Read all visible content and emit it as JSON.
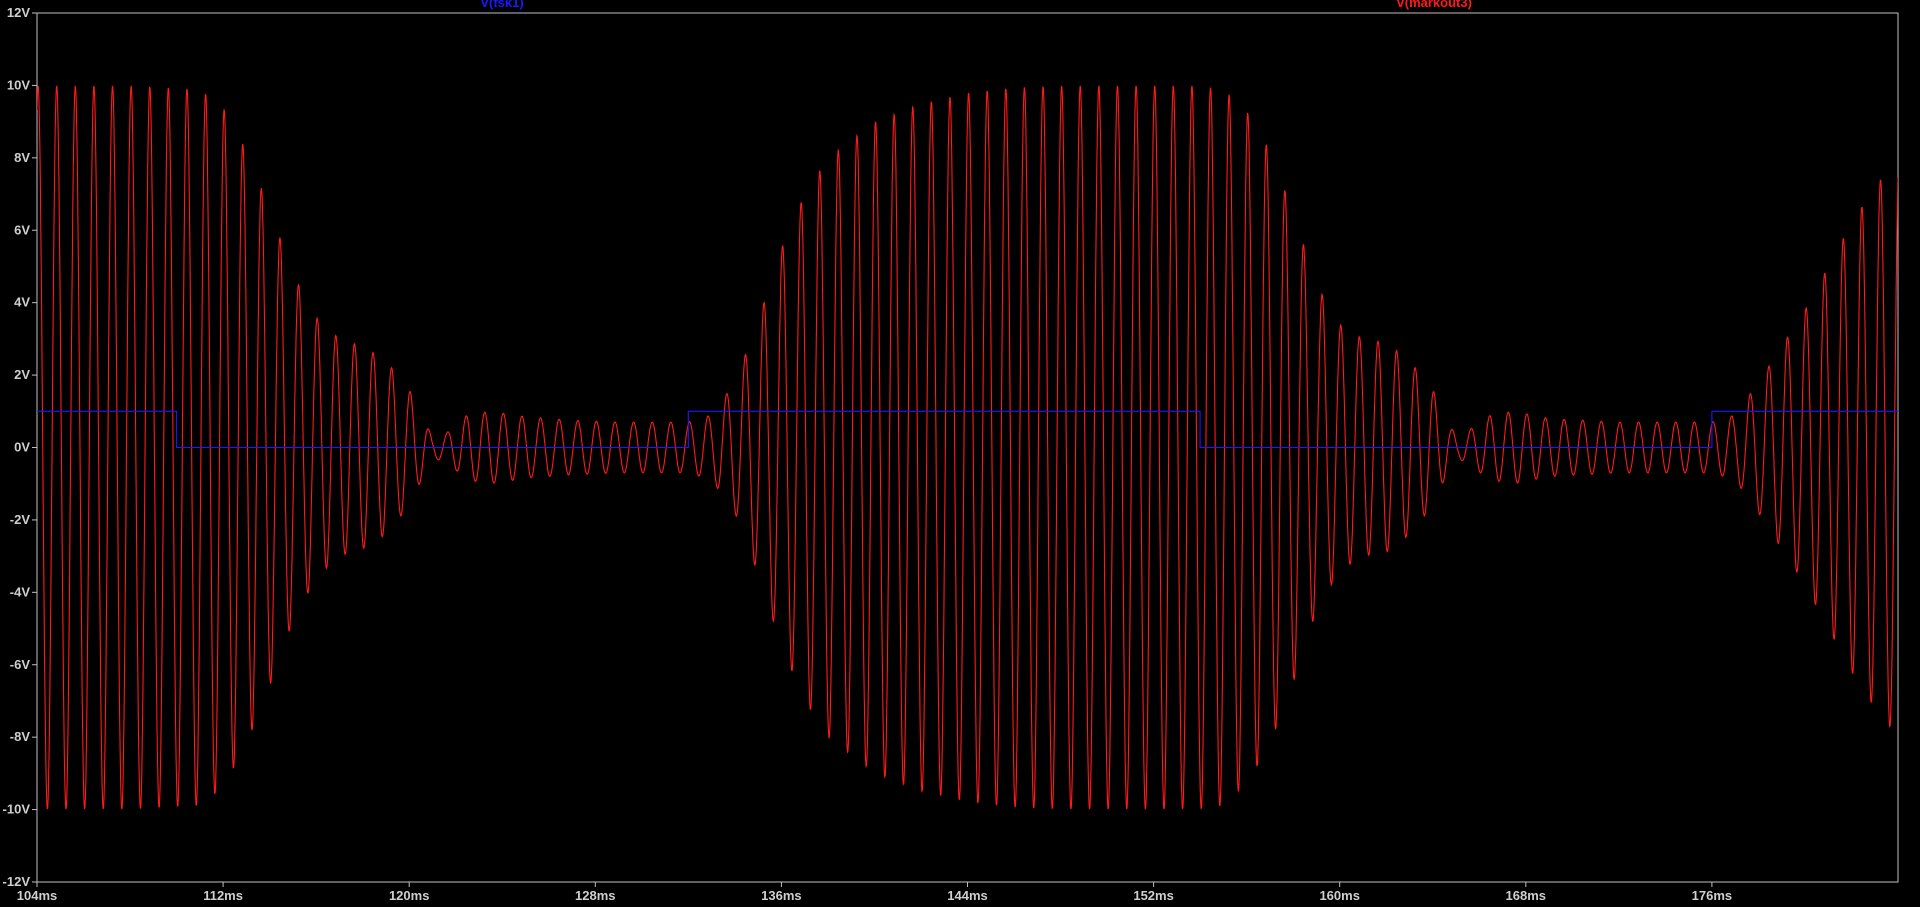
{
  "colors": {
    "background": "#000000",
    "frame": "#c0c0c0",
    "tick_text": "#cfcfcf",
    "trace_blue": "#1a1aff",
    "trace_red": "#ff1a1a"
  },
  "chart_data": {
    "type": "line",
    "title": "",
    "xlabel": "",
    "ylabel": "",
    "x_unit": "ms",
    "y_unit": "V",
    "xlim": [
      104,
      184
    ],
    "ylim": [
      -12,
      12
    ],
    "grid": false,
    "x_ticks": [
      104,
      112,
      120,
      128,
      136,
      144,
      152,
      160,
      168,
      176
    ],
    "x_tick_labels": [
      "104ms",
      "112ms",
      "120ms",
      "128ms",
      "136ms",
      "144ms",
      "152ms",
      "160ms",
      "168ms",
      "176ms"
    ],
    "y_ticks": [
      12,
      10,
      8,
      6,
      4,
      2,
      0,
      -2,
      -4,
      -6,
      -8,
      -10,
      -12
    ],
    "y_tick_labels": [
      "12V",
      "10V",
      "8V",
      "6V",
      "4V",
      "2V",
      "0V",
      "-2V",
      "-4V",
      "-6V",
      "-8V",
      "-10V",
      "-12V"
    ],
    "series": [
      {
        "name": "V(fsk1)",
        "color": "#1a1aff",
        "kind": "digital",
        "x": [
          104,
          110,
          110,
          132,
          132,
          154,
          154,
          176,
          176,
          184
        ],
        "y": [
          1,
          1,
          0,
          0,
          1,
          1,
          0,
          0,
          1,
          1
        ]
      },
      {
        "name": "V(markout3)",
        "color": "#ff1a1a",
        "kind": "am_carrier",
        "carrier_period_ms": 0.8,
        "envelope": {
          "x": [
            104,
            108,
            111,
            112,
            113,
            114,
            115,
            116,
            117,
            118,
            119,
            120,
            120.6,
            121,
            121.6,
            122.5,
            123.5,
            125,
            127,
            129,
            132,
            133,
            134,
            135,
            136,
            137,
            138,
            140,
            142,
            144,
            146,
            148,
            150,
            152,
            154,
            155,
            156,
            157,
            158,
            159,
            160,
            161,
            162,
            163,
            164,
            164.7,
            165.1,
            165.6,
            166.5,
            167.5,
            169,
            172,
            176,
            177,
            178,
            179,
            180,
            181,
            182,
            183,
            184
          ],
          "y": [
            10,
            10,
            9.9,
            9.4,
            8.2,
            6.6,
            4.8,
            3.6,
            3,
            2.8,
            2.4,
            1.6,
            0.8,
            0.3,
            0.4,
            0.9,
            1,
            0.85,
            0.75,
            0.7,
            0.7,
            0.9,
            1.8,
            3.5,
            5.5,
            7,
            8,
            9,
            9.5,
            9.8,
            9.95,
            10,
            10,
            10,
            10,
            9.9,
            9.3,
            8.2,
            6.5,
            4.5,
            3.4,
            3,
            2.9,
            2.4,
            1.6,
            0.6,
            0.3,
            0.5,
            0.9,
            1,
            0.8,
            0.7,
            0.7,
            0.9,
            1.8,
            2.8,
            3.8,
            5,
            6.2,
            7.2,
            8
          ]
        }
      }
    ]
  }
}
